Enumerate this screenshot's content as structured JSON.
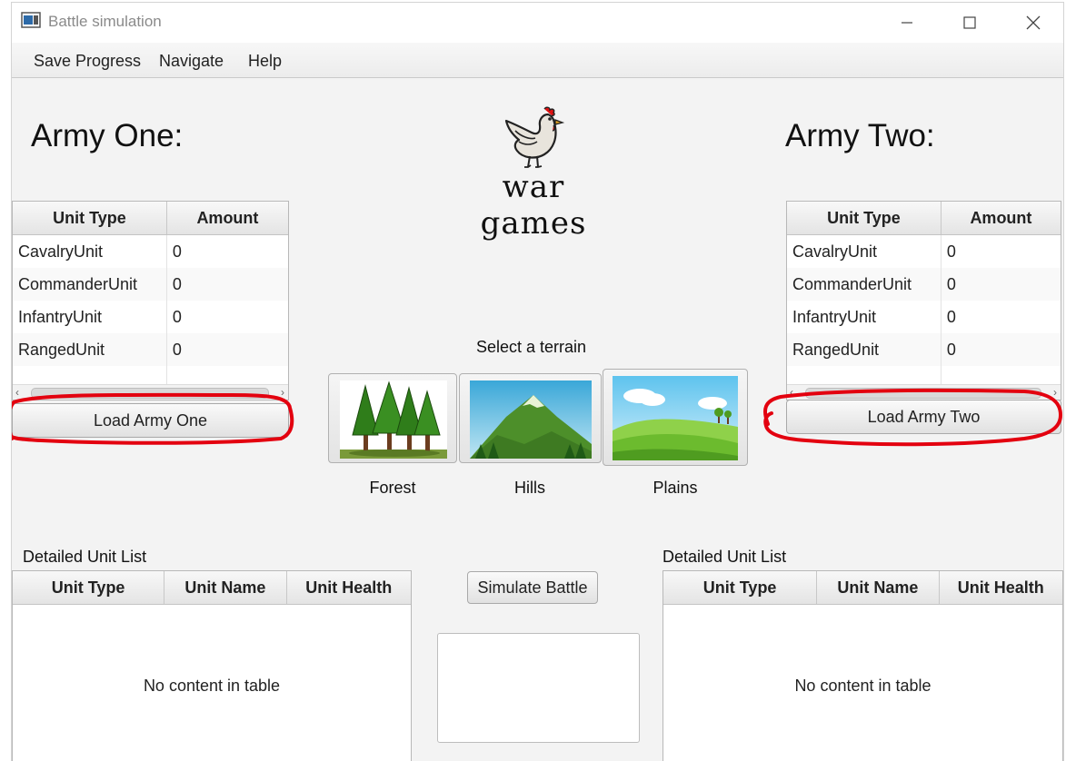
{
  "window": {
    "title": "Battle simulation"
  },
  "menu": {
    "items": [
      "Save Progress",
      "Navigate",
      "Help"
    ]
  },
  "logo": {
    "line1": "war",
    "line2": "games"
  },
  "army_one": {
    "title": "Army One:",
    "columns": [
      "Unit Type",
      "Amount"
    ],
    "rows": [
      [
        "CavalryUnit",
        "0"
      ],
      [
        "CommanderUnit",
        "0"
      ],
      [
        "InfantryUnit",
        "0"
      ],
      [
        "RangedUnit",
        "0"
      ]
    ],
    "load_button": "Load Army One"
  },
  "army_two": {
    "title": "Army Two:",
    "columns": [
      "Unit Type",
      "Amount"
    ],
    "rows": [
      [
        "CavalryUnit",
        "0"
      ],
      [
        "CommanderUnit",
        "0"
      ],
      [
        "InfantryUnit",
        "0"
      ],
      [
        "RangedUnit",
        "0"
      ]
    ],
    "load_button": "Load Army Two"
  },
  "terrain": {
    "prompt": "Select a terrain",
    "options": [
      {
        "name": "Forest",
        "icon": "forest-icon"
      },
      {
        "name": "Hills",
        "icon": "hills-icon"
      },
      {
        "name": "Plains",
        "icon": "plains-icon"
      }
    ]
  },
  "detail_one": {
    "label": "Detailed Unit List",
    "columns": [
      "Unit Type",
      "Unit Name",
      "Unit Health"
    ],
    "empty": "No content in table"
  },
  "detail_two": {
    "label": "Detailed Unit List",
    "columns": [
      "Unit Type",
      "Unit Name",
      "Unit Health"
    ],
    "empty": "No content in table"
  },
  "simulate_button": "Simulate Battle",
  "battle_log": {
    "value": ""
  },
  "colors": {
    "annotation": "#e3000f",
    "window_bg": "#f3f3f3"
  }
}
